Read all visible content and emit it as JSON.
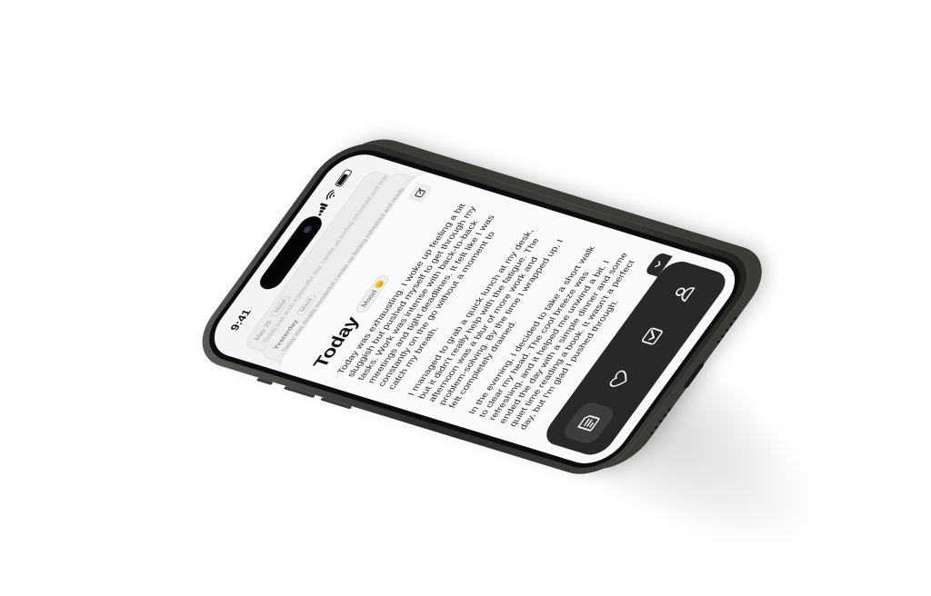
{
  "status_bar": {
    "time": "9:41"
  },
  "stack": {
    "date": "May 25",
    "mood_label": "Mood",
    "preview": "Today was such a peaceful day. I woke up feeling refreshed and ready to embrace the day. The sun was shining brightly, and I decided to start"
  },
  "yesterday": {
    "label": "Yesterday",
    "mood_label": "Mood",
    "preview": "Today was simply wonderful! I woke up feeling refreshed and ready to embrace the day. The sun was shining brightly, and I decided to start the morning with a walk."
  },
  "today": {
    "title": "Today",
    "mood_label": "Mood",
    "paragraphs": [
      "Today was exhausting. I woke up feeling a bit sluggish but pushed myself to get through my tasks. Work was intense with back-to-back meetings and tight deadlines. It felt like I was constantly on the go without a moment to catch my breath.",
      "I managed to grab a quick lunch at my desk, but it didn't really help with the fatigue. The afternoon was a blur of more work and problem-solving. By the time I wrapped up, I felt completely drained.",
      "In the evening, I decided to take a short walk to clear my head. The cool breeze was refreshing, and it helped me unwind a bit. I ended the day with a simple dinner and some quiet time reading a book. It wasn't a perfect day, but I'm glad I pushed through."
    ]
  },
  "icons": {
    "edit": "edit-icon",
    "collapse": "chevron-down-icon",
    "tabs": [
      "journal-icon",
      "heart-icon",
      "checkbox-icon",
      "profile-icon"
    ]
  },
  "colors": {
    "tab_bar": "#282828",
    "screen_bg": "#f4f4f4",
    "frame": "#2b2d2a"
  }
}
